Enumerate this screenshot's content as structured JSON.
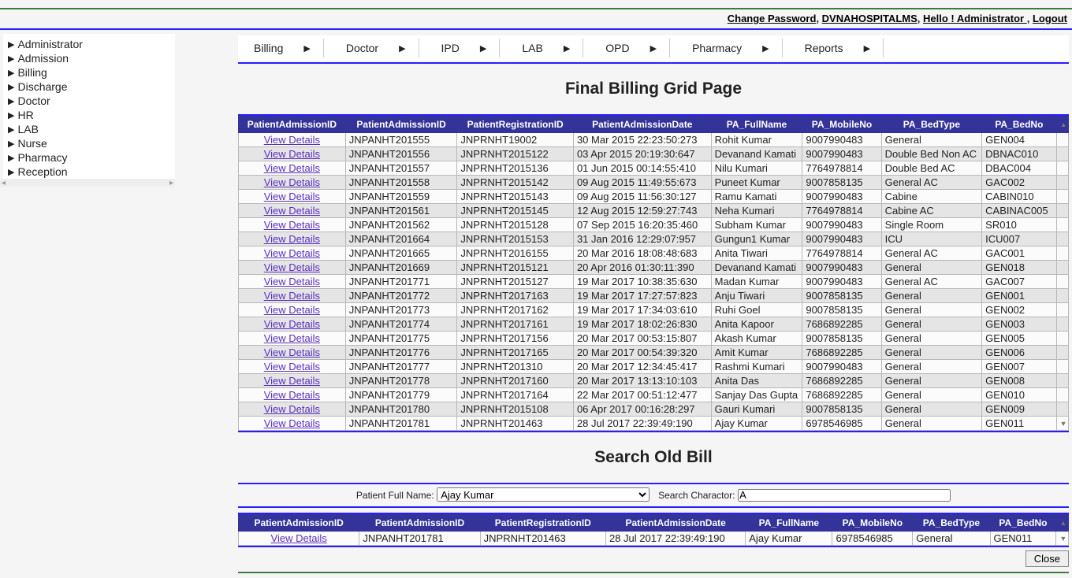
{
  "userbar": {
    "change_password": "Change Password",
    "org": "DVNAHOSPITALMS",
    "hello": "Hello ! Administrator ",
    "logout": "Logout"
  },
  "sidebar": {
    "items": [
      {
        "label": "Administrator"
      },
      {
        "label": "Admission"
      },
      {
        "label": "Billing"
      },
      {
        "label": "Discharge"
      },
      {
        "label": "Doctor"
      },
      {
        "label": "HR"
      },
      {
        "label": "LAB"
      },
      {
        "label": "Nurse"
      },
      {
        "label": "Pharmacy"
      },
      {
        "label": "Reception"
      }
    ]
  },
  "topmenu": {
    "items": [
      {
        "label": "Billing"
      },
      {
        "label": "Doctor"
      },
      {
        "label": "IPD"
      },
      {
        "label": "LAB"
      },
      {
        "label": "OPD"
      },
      {
        "label": "Pharmacy"
      },
      {
        "label": "Reports"
      }
    ]
  },
  "page_title": "Final Billing Grid Page",
  "grid": {
    "view_details_label": "View Details",
    "headers": [
      "PatientAdmissionID",
      "PatientAdmissionID",
      "PatientRegistrationID",
      "PatientAdmissionDate",
      "PA_FullName",
      "PA_MobileNo",
      "PA_BedType",
      "PA_BedNo"
    ],
    "rows": [
      {
        "adm": "JNPANHT201555",
        "reg": "JNPRNHT19002",
        "date": "30 Mar 2015 22:23:50:273",
        "name": "Rohit Kumar",
        "mob": "9007990483",
        "bedtype": "General",
        "bedno": "GEN004"
      },
      {
        "adm": "JNPANHT201556",
        "reg": "JNPRNHT2015122",
        "date": "03 Apr 2015 20:19:30:647",
        "name": "Devanand Kamati",
        "mob": "9007990483",
        "bedtype": "Double Bed Non AC",
        "bedno": "DBNAC010"
      },
      {
        "adm": "JNPANHT201557",
        "reg": "JNPRNHT2015136",
        "date": "01 Jun 2015 00:14:55:410",
        "name": "Nilu Kumari",
        "mob": "7764978814",
        "bedtype": "Double Bed AC",
        "bedno": "DBAC004"
      },
      {
        "adm": "JNPANHT201558",
        "reg": "JNPRNHT2015142",
        "date": "09 Aug 2015 11:49:55:673",
        "name": "Puneet Kumar",
        "mob": "9007858135",
        "bedtype": "General AC",
        "bedno": "GAC002"
      },
      {
        "adm": "JNPANHT201559",
        "reg": "JNPRNHT2015143",
        "date": "09 Aug 2015 11:56:30:127",
        "name": "Ramu Kamati",
        "mob": "9007990483",
        "bedtype": "Cabine",
        "bedno": "CABIN010"
      },
      {
        "adm": "JNPANHT201561",
        "reg": "JNPRNHT2015145",
        "date": "12 Aug 2015 12:59:27:743",
        "name": "Neha Kumari",
        "mob": "7764978814",
        "bedtype": "Cabine AC",
        "bedno": "CABINAC005"
      },
      {
        "adm": "JNPANHT201562",
        "reg": "JNPRNHT2015128",
        "date": "07 Sep 2015 16:20:35:460",
        "name": "Subham Kumar",
        "mob": "9007990483",
        "bedtype": "Single Room",
        "bedno": "SR010"
      },
      {
        "adm": "JNPANHT201664",
        "reg": "JNPRNHT2015153",
        "date": "31 Jan 2016 12:29:07:957",
        "name": "Gungun1 Kumar",
        "mob": "9007990483",
        "bedtype": "ICU",
        "bedno": "ICU007"
      },
      {
        "adm": "JNPANHT201665",
        "reg": "JNPRNHT2016155",
        "date": "20 Mar 2016 18:08:48:683",
        "name": "Anita Tiwari",
        "mob": "7764978814",
        "bedtype": "General AC",
        "bedno": "GAC001"
      },
      {
        "adm": "JNPANHT201669",
        "reg": "JNPRNHT2015121",
        "date": "20 Apr 2016 01:30:11:390",
        "name": "Devanand Kamati",
        "mob": "9007990483",
        "bedtype": "General",
        "bedno": "GEN018"
      },
      {
        "adm": "JNPANHT201771",
        "reg": "JNPRNHT2015127",
        "date": "19 Mar 2017 10:38:35:630",
        "name": "Madan Kumar",
        "mob": "9007990483",
        "bedtype": "General AC",
        "bedno": "GAC007"
      },
      {
        "adm": "JNPANHT201772",
        "reg": "JNPRNHT2017163",
        "date": "19 Mar 2017 17:27:57:823",
        "name": "Anju Tiwari",
        "mob": "9007858135",
        "bedtype": "General",
        "bedno": "GEN001"
      },
      {
        "adm": "JNPANHT201773",
        "reg": "JNPRNHT2017162",
        "date": "19 Mar 2017 17:34:03:610",
        "name": "Ruhi Goel",
        "mob": "9007858135",
        "bedtype": "General",
        "bedno": "GEN002"
      },
      {
        "adm": "JNPANHT201774",
        "reg": "JNPRNHT2017161",
        "date": "19 Mar 2017 18:02:26:830",
        "name": "Anita Kapoor",
        "mob": "7686892285",
        "bedtype": "General",
        "bedno": "GEN003"
      },
      {
        "adm": "JNPANHT201775",
        "reg": "JNPRNHT2017156",
        "date": "20 Mar 2017 00:53:15:807",
        "name": "Akash Kumar",
        "mob": "9007858135",
        "bedtype": "General",
        "bedno": "GEN005"
      },
      {
        "adm": "JNPANHT201776",
        "reg": "JNPRNHT2017165",
        "date": "20 Mar 2017 00:54:39:320",
        "name": "Amit Kumar",
        "mob": "7686892285",
        "bedtype": "General",
        "bedno": "GEN006"
      },
      {
        "adm": "JNPANHT201777",
        "reg": "JNPRNHT201310",
        "date": "20 Mar 2017 12:34:45:417",
        "name": "Rashmi Kumari",
        "mob": "9007990483",
        "bedtype": "General",
        "bedno": "GEN007"
      },
      {
        "adm": "JNPANHT201778",
        "reg": "JNPRNHT2017160",
        "date": "20 Mar 2017 13:13:10:103",
        "name": "Anita Das",
        "mob": "7686892285",
        "bedtype": "General",
        "bedno": "GEN008"
      },
      {
        "adm": "JNPANHT201779",
        "reg": "JNPRNHT2017164",
        "date": "22 Mar 2017 00:51:12:477",
        "name": "Sanjay Das Gupta",
        "mob": "7686892285",
        "bedtype": "General",
        "bedno": "GEN010"
      },
      {
        "adm": "JNPANHT201780",
        "reg": "JNPRNHT2015108",
        "date": "06 Apr 2017 00:16:28:297",
        "name": "Gauri Kumari",
        "mob": "9007858135",
        "bedtype": "General",
        "bedno": "GEN009"
      },
      {
        "adm": "JNPANHT201781",
        "reg": "JNPRNHT201463",
        "date": "28 Jul 2017 22:39:49:190",
        "name": "Ajay Kumar",
        "mob": "6978546985",
        "bedtype": "General",
        "bedno": "GEN011"
      }
    ]
  },
  "search": {
    "title": "Search Old Bill",
    "fullname_label": "Patient Full Name:",
    "fullname_value": "Ajay Kumar",
    "char_label": "Search Charactor:",
    "char_value": "A"
  },
  "result_grid": {
    "headers": [
      "PatientAdmissionID",
      "PatientAdmissionID",
      "PatientRegistrationID",
      "PatientAdmissionDate",
      "PA_FullName",
      "PA_MobileNo",
      "PA_BedType",
      "PA_BedNo"
    ],
    "row": {
      "adm": "JNPANHT201781",
      "reg": "JNPRNHT201463",
      "date": "28 Jul 2017 22:39:49:190",
      "name": "Ajay Kumar",
      "mob": "6978546985",
      "bedtype": "General",
      "bedno": "GEN011"
    }
  },
  "close_label": "Close"
}
